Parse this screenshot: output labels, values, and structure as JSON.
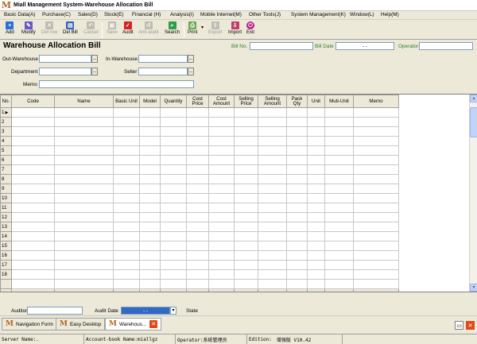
{
  "window": {
    "title": "Miall Management System-Warehouse Allocation Bill"
  },
  "menu": [
    "Basic Data(A)",
    "Purchase(C)",
    "Sales(D)",
    "Stock(E)",
    "Financial (H)",
    "Analysis(I)",
    "Mobile Internet(M)",
    "Other Tools(J)",
    "System Management(K)",
    "Window(L)",
    "Help(M)"
  ],
  "toolbar": {
    "add": "Add",
    "modify": "Modify",
    "delete": "Del row",
    "del_bill": "Del Bill",
    "cancel": "Cancel",
    "save": "Save",
    "audit": "Audit",
    "anti_audit": "Anti-audit",
    "search": "Search",
    "print": "Print",
    "export": "Export",
    "import": "Import",
    "exit": "Exit"
  },
  "form": {
    "title": "Warehouse Allocation Bill",
    "bill_no_label": "Bill No.",
    "bill_no": "",
    "bill_date_label": "Bill Date",
    "bill_date": "  -  -",
    "operator_label": "Operator",
    "operator": "",
    "out_warehouse_label": "Out-Warehouse",
    "out_warehouse": "",
    "in_warehouse_label": "In-Warehouse",
    "in_warehouse": "",
    "department_label": "Department",
    "department": "",
    "seller_label": "Seller",
    "seller": "",
    "memo_label": "Memo",
    "memo": "",
    "lookup_glyph": "..."
  },
  "grid": {
    "columns": [
      "No.",
      "Code",
      "Name",
      "Basic Unit",
      "Model",
      "Quantity",
      "Cost Price",
      "Cost Amount",
      "Selling Price",
      "Selling Amount",
      "Pack Qty",
      "Unit",
      "Muti-Unit",
      "Memo"
    ],
    "rows": [
      "1",
      "2",
      "3",
      "4",
      "5",
      "6",
      "7",
      "8",
      "9",
      "10",
      "11",
      "12",
      "13",
      "14",
      "15",
      "16",
      "17",
      "18"
    ],
    "current_row_marker": "▶",
    "total": {
      "no": "60",
      "label": "Total",
      "quantity": "0",
      "cost_amount": "0",
      "selling_amount": "0"
    }
  },
  "footer": {
    "auditor_label": "Auditor",
    "auditor": "",
    "audit_date_label": "Audit Date",
    "audit_date": "  -  -",
    "state_label": "State"
  },
  "tabs": [
    {
      "label": "Navigation Form",
      "icon": "logo-icon"
    },
    {
      "label": "Easy Desktop",
      "icon": "logo-icon"
    },
    {
      "label": "Warehous...",
      "icon": "logo-icon"
    }
  ],
  "status": {
    "server": "Server Name:.",
    "account": "Account-book Name:miallgz",
    "operator": "Operator:系统管理员",
    "edition_label": "Edition:",
    "edition": "增强版 V10.42"
  },
  "colors": {
    "accent_blue": "#316ac5",
    "logo": "#b5651d",
    "label_green": "#2f7d2f"
  }
}
